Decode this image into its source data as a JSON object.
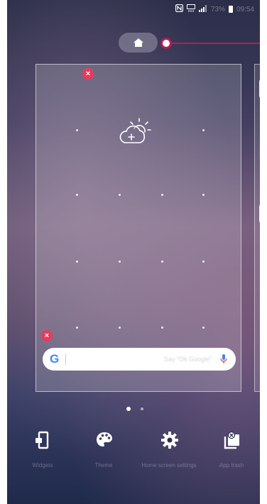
{
  "status_bar": {
    "nfc_icon": "nfc-icon",
    "data_icon": "mobile-data-icon",
    "signal_icon": "signal-icon",
    "battery_text": "73%",
    "battery_icon": "battery-icon",
    "time": "09:54"
  },
  "home_button": {
    "icon": "home-icon"
  },
  "home_page": {
    "weather_widget_icon": "add-weather-icon",
    "search": {
      "logo": "G",
      "placeholder": "Say “Ok Google”",
      "mic_icon": "microphone-icon"
    }
  },
  "page_indicator": {
    "pages": 2,
    "current": 1
  },
  "bottom_bar": {
    "items": [
      {
        "label": "Widgets",
        "icon": "widgets-icon"
      },
      {
        "label": "Theme",
        "icon": "palette-icon"
      },
      {
        "label": "Home screen settings",
        "icon": "gear-icon"
      },
      {
        "label": "App trash",
        "icon": "app-trash-icon"
      }
    ]
  },
  "colors": {
    "accent": "#b01e57",
    "remove_badge": "#e83a5c"
  }
}
